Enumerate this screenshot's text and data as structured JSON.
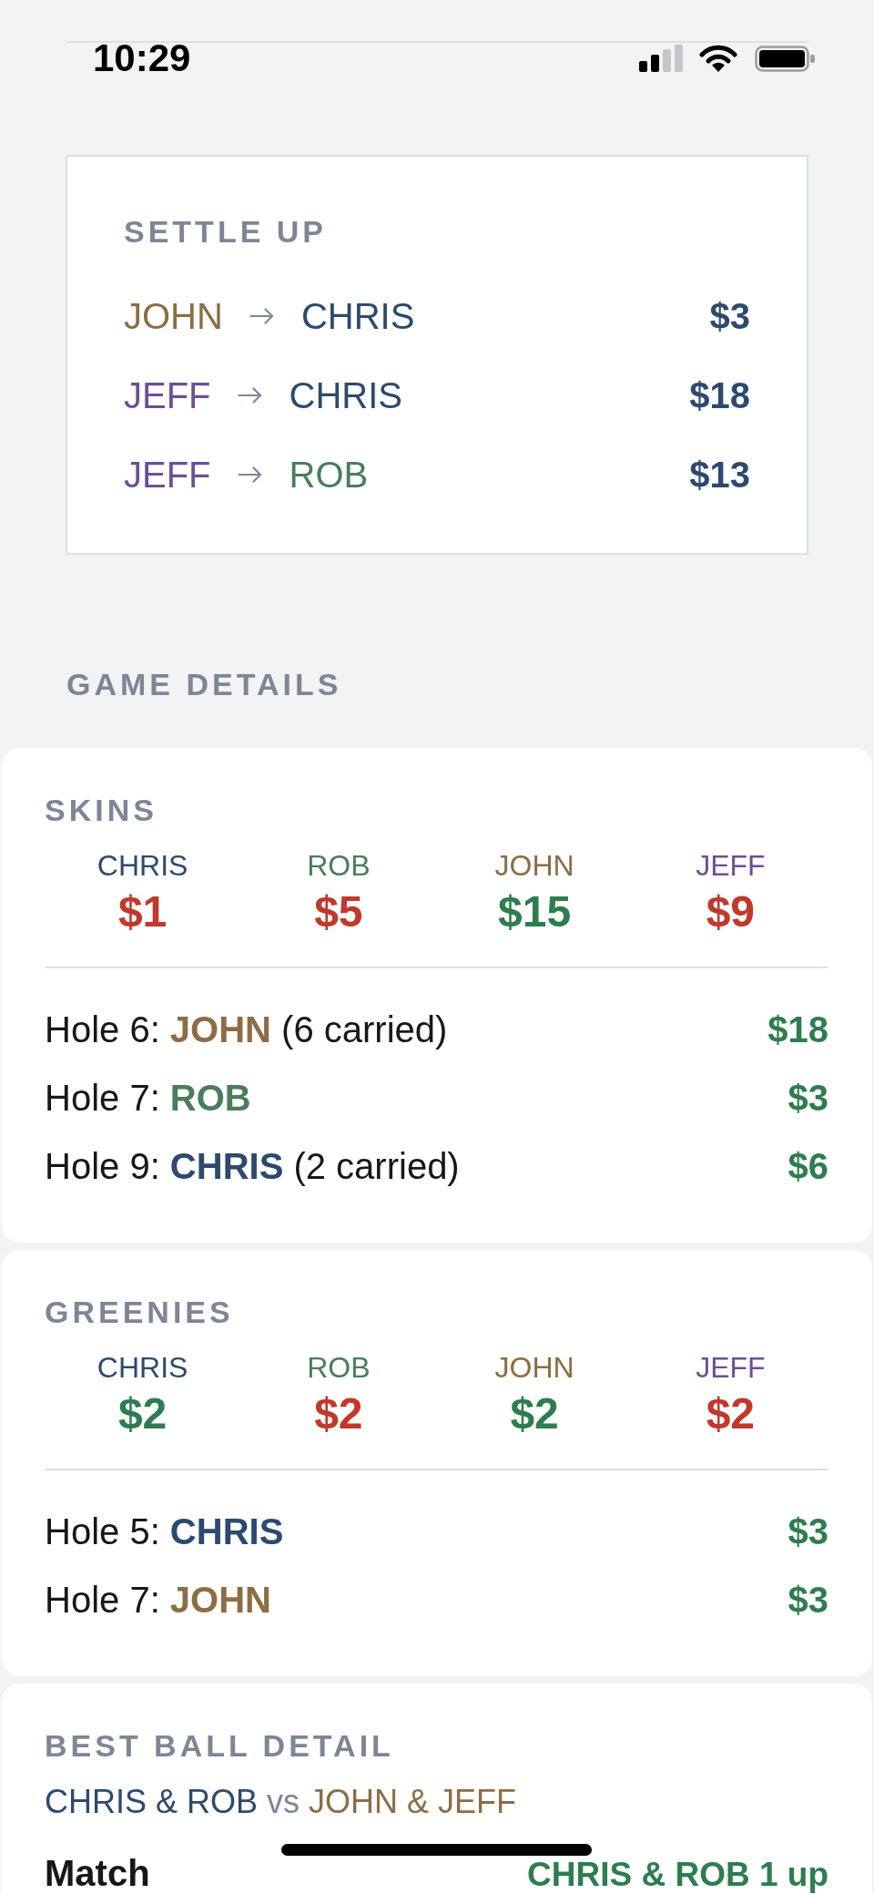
{
  "status_bar": {
    "time": "10:29"
  },
  "settle_up": {
    "title": "SETTLE UP",
    "rows": [
      {
        "from": {
          "name": "JOHN",
          "color": "#8c6d45"
        },
        "to": {
          "name": "CHRIS",
          "color": "#2d4a6e"
        },
        "amount": "$3"
      },
      {
        "from": {
          "name": "JEFF",
          "color": "#6c5096"
        },
        "to": {
          "name": "CHRIS",
          "color": "#2d4a6e"
        },
        "amount": "$18"
      },
      {
        "from": {
          "name": "JEFF",
          "color": "#6c5096"
        },
        "to": {
          "name": "ROB",
          "color": "#4a7d5a"
        },
        "amount": "$13"
      }
    ]
  },
  "game_details": {
    "title": "GAME DETAILS",
    "games": [
      {
        "kind": "payouts",
        "title": "SKINS",
        "players": [
          {
            "name": "CHRIS",
            "color": "#2d4a6e",
            "amount": "$1",
            "positive": false
          },
          {
            "name": "ROB",
            "color": "#4a7d5a",
            "amount": "$5",
            "positive": false
          },
          {
            "name": "JOHN",
            "color": "#8c6d45",
            "amount": "$15",
            "positive": true
          },
          {
            "name": "JEFF",
            "color": "#6c5096",
            "amount": "$9",
            "positive": false
          }
        ],
        "holes": [
          {
            "label": "Hole 6:",
            "winner": {
              "name": "JOHN",
              "color": "#8c6d45"
            },
            "note": "(6 carried)",
            "amount": "$18"
          },
          {
            "label": "Hole 7:",
            "winner": {
              "name": "ROB",
              "color": "#4a7d5a"
            },
            "amount": "$3"
          },
          {
            "label": "Hole 9:",
            "winner": {
              "name": "CHRIS",
              "color": "#2d4a6e"
            },
            "note": "(2 carried)",
            "amount": "$6"
          }
        ]
      },
      {
        "kind": "payouts",
        "title": "GREENIES",
        "players": [
          {
            "name": "CHRIS",
            "color": "#2d4a6e",
            "amount": "$2",
            "positive": true
          },
          {
            "name": "ROB",
            "color": "#4a7d5a",
            "amount": "$2",
            "positive": false
          },
          {
            "name": "JOHN",
            "color": "#8c6d45",
            "amount": "$2",
            "positive": true
          },
          {
            "name": "JEFF",
            "color": "#6c5096",
            "amount": "$2",
            "positive": false
          }
        ],
        "holes": [
          {
            "label": "Hole 5:",
            "winner": {
              "name": "CHRIS",
              "color": "#2d4a6e"
            },
            "amount": "$3"
          },
          {
            "label": "Hole 7:",
            "winner": {
              "name": "JOHN",
              "color": "#8c6d45"
            },
            "amount": "$3"
          }
        ]
      },
      {
        "kind": "best_ball",
        "title": "BEST BALL DETAIL",
        "teams": [
          {
            "name": "CHRIS & ROB",
            "color": "#2d4a6e"
          },
          {
            "name": "JOHN & JEFF",
            "color": "#8c6d45"
          }
        ],
        "separator": "vs",
        "match": {
          "label": "Match",
          "result": "CHRIS & ROB 1 up"
        }
      }
    ]
  }
}
